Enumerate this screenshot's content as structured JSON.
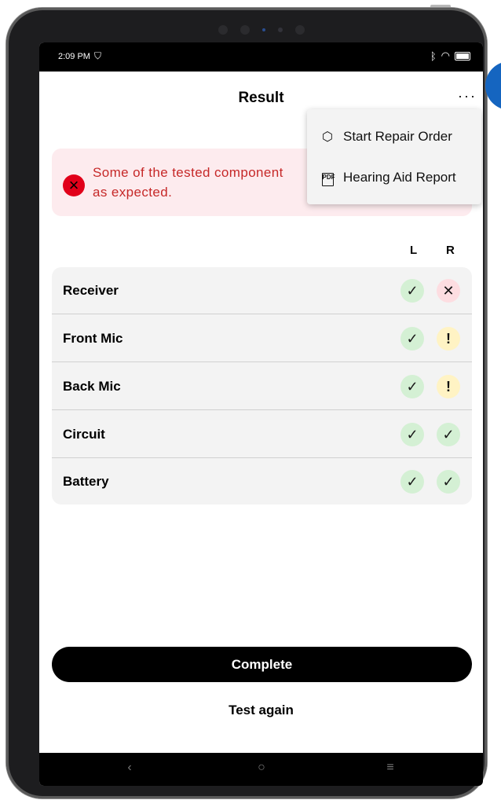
{
  "statusbar": {
    "time": "2:09 PM",
    "vpn_icon": "vpn-shield-icon",
    "bluetooth_icon": "bluetooth-icon",
    "wifi_icon": "wifi-icon",
    "battery_icon": "battery-icon"
  },
  "header": {
    "title": "Result",
    "more_label": "···"
  },
  "menu": {
    "items": [
      {
        "label": "Start Repair Order",
        "icon": "package-icon"
      },
      {
        "label": "Hearing Aid Report",
        "icon": "pdf-icon"
      }
    ]
  },
  "alert": {
    "text": "Some of the tested components did not respond as expected.",
    "visible_text": "Some of the tested component as expected.",
    "icon": "error-x-icon",
    "color": "#c62828"
  },
  "columns": {
    "left": "L",
    "right": "R"
  },
  "results": [
    {
      "name": "Receiver",
      "left": "ok",
      "right": "fail"
    },
    {
      "name": "Front Mic",
      "left": "ok",
      "right": "warn"
    },
    {
      "name": "Back Mic",
      "left": "ok",
      "right": "warn"
    },
    {
      "name": "Circuit",
      "left": "ok",
      "right": "ok"
    },
    {
      "name": "Battery",
      "left": "ok",
      "right": "ok"
    }
  ],
  "actions": {
    "complete": "Complete",
    "test_again": "Test again"
  },
  "navbar": {
    "back": "‹",
    "home": "○",
    "menu": "≡"
  },
  "colors": {
    "ok_bg": "#d4f0d4",
    "fail_bg": "#fddde1",
    "warn_bg": "#fff3c4",
    "primary": "#000000",
    "fab": "#1565c0"
  }
}
